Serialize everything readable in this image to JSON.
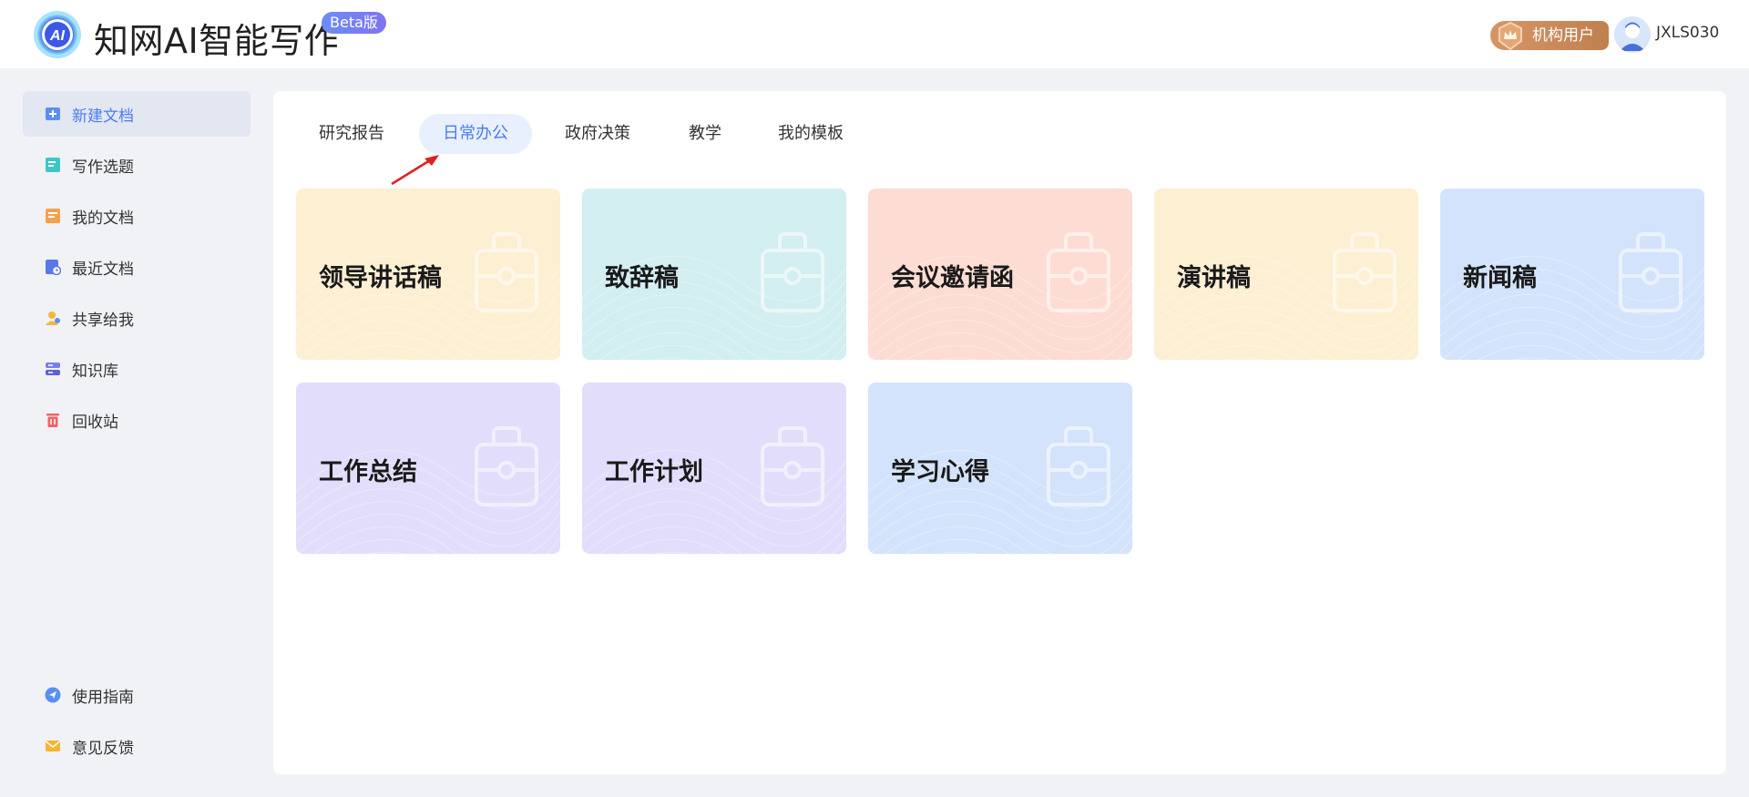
{
  "header": {
    "app_title": "知网AI智能写作",
    "beta_label": "Beta版",
    "org_label": "机构用户",
    "username": "JXLS030",
    "logo_text": "AI"
  },
  "sidebar": {
    "items": [
      {
        "label": "新建文档",
        "icon": "new-doc-icon",
        "active": true
      },
      {
        "label": "写作选题",
        "icon": "topic-icon"
      },
      {
        "label": "我的文档",
        "icon": "my-docs-icon"
      },
      {
        "label": "最近文档",
        "icon": "recent-docs-icon"
      },
      {
        "label": "共享给我",
        "icon": "shared-icon"
      },
      {
        "label": "知识库",
        "icon": "knowledge-base-icon"
      },
      {
        "label": "回收站",
        "icon": "recycle-bin-icon"
      }
    ],
    "bottom_items": [
      {
        "label": "使用指南",
        "icon": "guide-icon"
      },
      {
        "label": "意见反馈",
        "icon": "feedback-icon"
      }
    ]
  },
  "tabs": [
    {
      "label": "研究报告"
    },
    {
      "label": "日常办公",
      "active": true
    },
    {
      "label": "政府决策"
    },
    {
      "label": "教学"
    },
    {
      "label": "我的模板"
    }
  ],
  "cards": [
    {
      "title": "领导讲话稿",
      "color": "#fdefd2"
    },
    {
      "title": "致辞稿",
      "color": "#d2eef0"
    },
    {
      "title": "会议邀请函",
      "color": "#fddcd3"
    },
    {
      "title": "演讲稿",
      "color": "#fdefd2"
    },
    {
      "title": "新闻稿",
      "color": "#d3e3fb"
    },
    {
      "title": "工作总结",
      "color": "#e2ddfb"
    },
    {
      "title": "工作计划",
      "color": "#e2ddfb"
    },
    {
      "title": "学习心得",
      "color": "#d3e3fb"
    }
  ],
  "colors": {
    "accent": "#4a7cf0",
    "active_tab_bg": "#e8f0fe",
    "page_bg": "#f0f2f6",
    "annotation_arrow": "#e02020"
  }
}
